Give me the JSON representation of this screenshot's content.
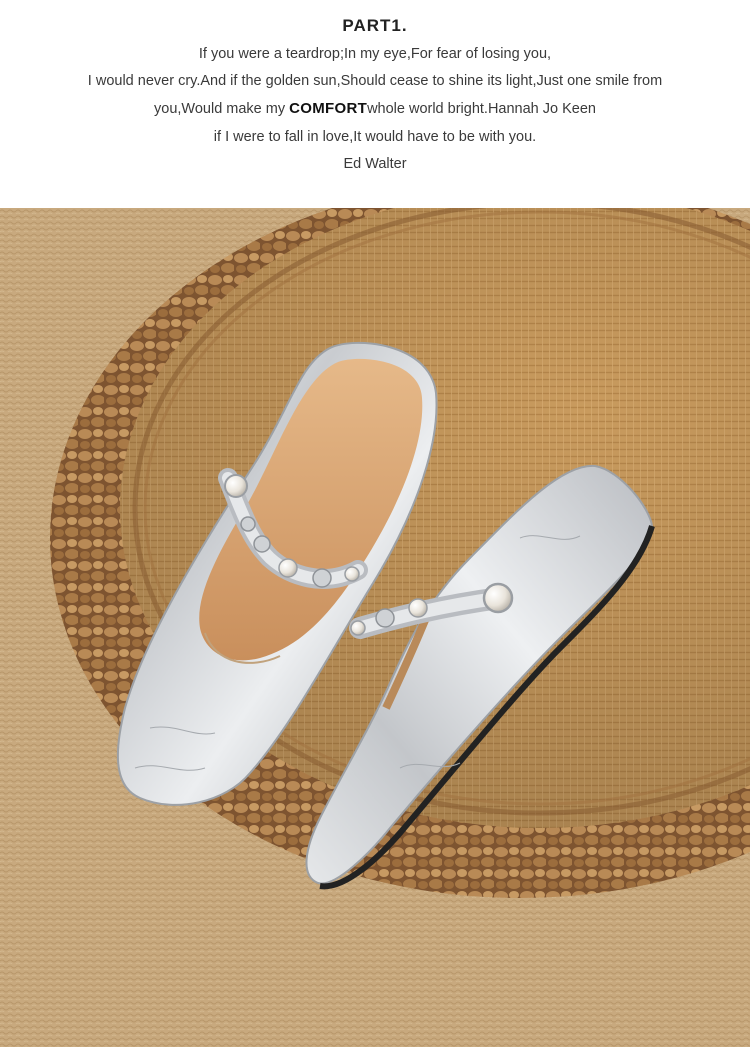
{
  "heading": "PART1.",
  "poem": {
    "line1": "If you were a teardrop;In my eye,For fear of losing you,",
    "line2": "I would never cry.And if the golden sun,Should cease to shine its light,Just one smile from",
    "line3_before": "you,Would make my ",
    "line3_emphasis": "COMFORT",
    "line3_after": "whole world bright.Hannah Jo Keen",
    "line4": "if I were to fall in love,It would have to be with you.",
    "line5": "Ed Walter"
  },
  "photo": {
    "subject": "silver-mule-flats-on-woven-pouf",
    "colors": {
      "rug": "#c9a97d",
      "pouf_top": "#c99a5c",
      "pouf_rim": "#8a5f33",
      "silver": "#d7d9dc",
      "lining": "#d9a877",
      "pearl": "#f3f0ea"
    }
  }
}
